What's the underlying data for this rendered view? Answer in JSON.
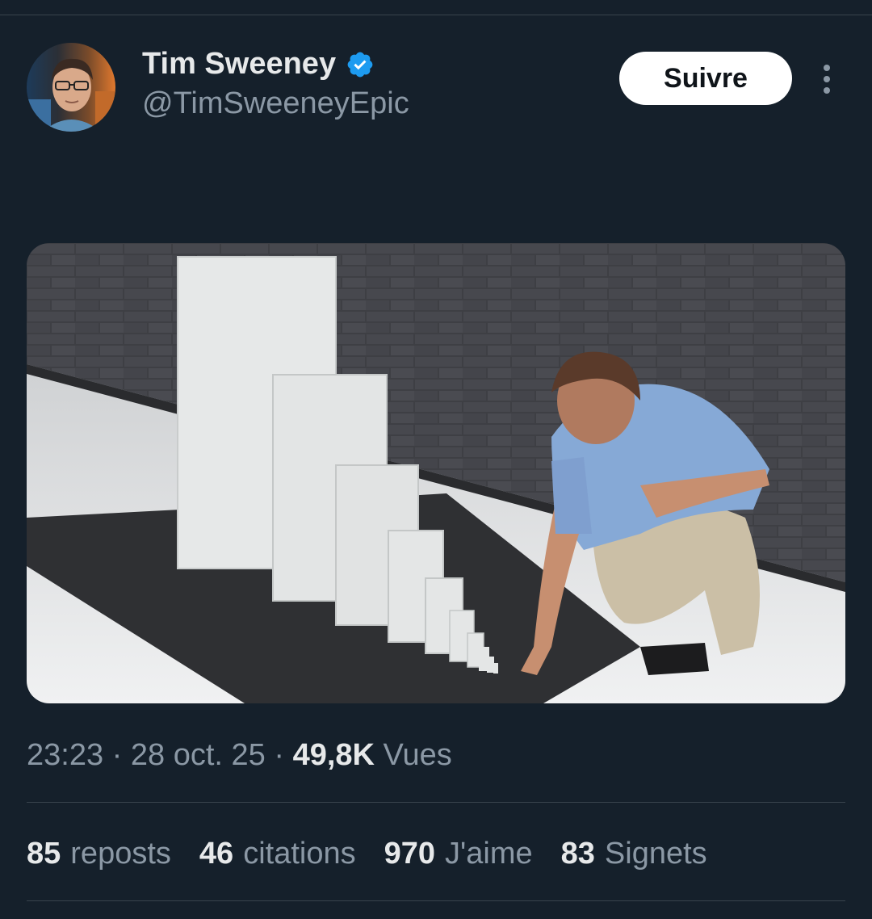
{
  "author": {
    "name": "Tim Sweeney",
    "handle": "@TimSweeneyEpic",
    "verified": true,
    "verified_color": "#1d9bf0"
  },
  "follow_button_label": "Suivre",
  "more_icon": "more-vertical-icon",
  "media": {
    "kind": "photo",
    "icon": "photo-icon"
  },
  "meta": {
    "time": "23:23",
    "separator": "·",
    "date": "28 oct. 25",
    "views_count": "49,8K",
    "views_label": "Vues"
  },
  "stats": [
    {
      "count": "85",
      "label": "reposts"
    },
    {
      "count": "46",
      "label": "citations"
    },
    {
      "count": "970",
      "label": "J'aime"
    },
    {
      "count": "83",
      "label": "Signets"
    }
  ],
  "colors": {
    "background": "#15202b",
    "text_primary": "#e7e9ea",
    "text_secondary": "#8b98a5",
    "divider": "#38444d",
    "button_bg": "#ffffff"
  }
}
